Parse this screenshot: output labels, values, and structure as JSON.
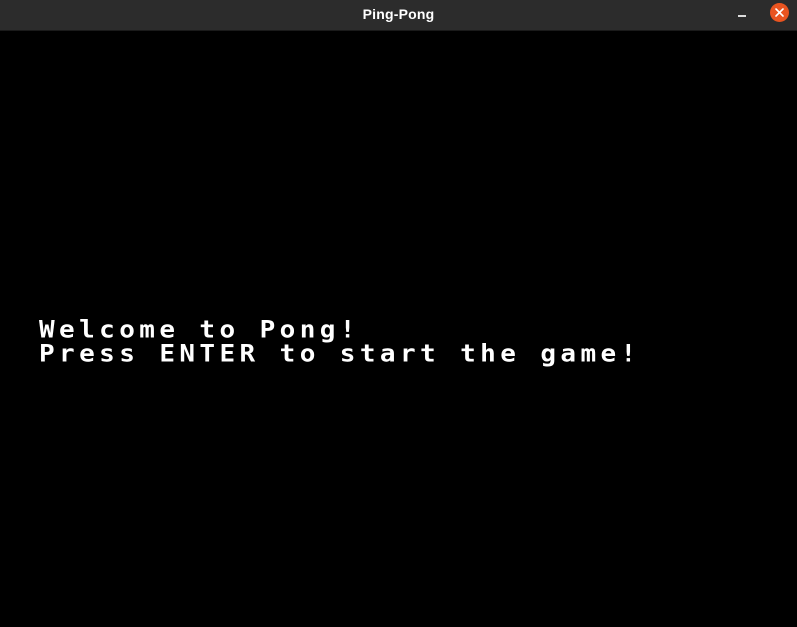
{
  "window": {
    "title": "Ping-Pong",
    "controls": {
      "minimize_icon": "minimize-icon",
      "close_icon": "close-icon",
      "close_color": "#e95420"
    }
  },
  "game": {
    "background": "#000000",
    "text_color": "#ffffff",
    "welcome_text": "Welcome to Pong!",
    "prompt_text": "Press ENTER to start the game!"
  }
}
